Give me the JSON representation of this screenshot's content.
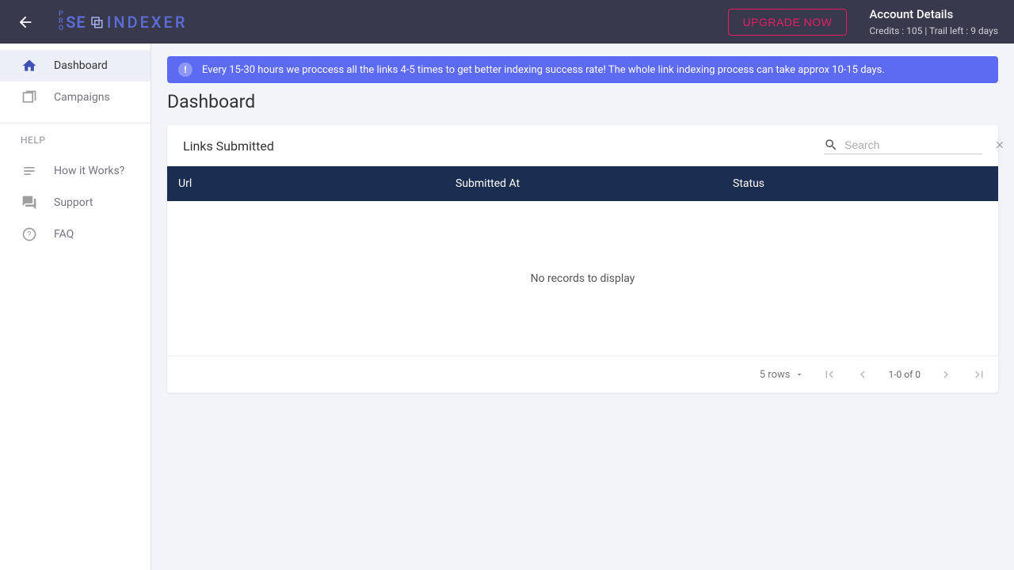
{
  "header": {
    "logo": {
      "pro": "PRO",
      "se": "SE",
      "indexer": "INDEXER"
    },
    "upgrade_label": "UPGRADE NOW",
    "account_title": "Account Details",
    "account_credits_label": "Credits : ",
    "account_credits_value": "105",
    "account_sep": " | ",
    "account_trail_label": "Trail left : ",
    "account_trail_value": "9 days"
  },
  "sidebar": {
    "items": [
      {
        "label": "Dashboard"
      },
      {
        "label": "Campaigns"
      }
    ],
    "help_section": "HELP",
    "help_items": [
      {
        "label": "How it Works?"
      },
      {
        "label": "Support"
      },
      {
        "label": "FAQ"
      }
    ]
  },
  "banner": {
    "text": "Every 15-30 hours we proccess all the links 4-5 times to get better indexing success rate! The whole link indexing process can take approx 10-15 days."
  },
  "page": {
    "title": "Dashboard"
  },
  "card": {
    "title": "Links Submitted",
    "search_placeholder": "Search",
    "columns": {
      "url": "Url",
      "submitted": "Submitted At",
      "status": "Status"
    },
    "empty_text": "No records to display",
    "footer": {
      "rows_label": "5 rows",
      "range": "1-0 of 0"
    }
  }
}
